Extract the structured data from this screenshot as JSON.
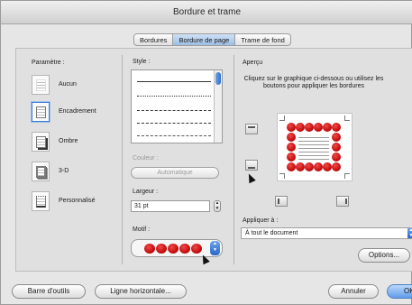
{
  "window": {
    "title": "Bordure et trame"
  },
  "tabs": [
    {
      "label": "Bordures"
    },
    {
      "label": "Bordure de page"
    },
    {
      "label": "Trame de fond"
    }
  ],
  "parametre": {
    "label": "Paramètre :",
    "items": [
      {
        "label": "Aucun",
        "icon": "border-none-icon"
      },
      {
        "label": "Encadrement",
        "icon": "border-box-icon",
        "selected": true
      },
      {
        "label": "Ombre",
        "icon": "border-shadow-icon"
      },
      {
        "label": "3-D",
        "icon": "border-3d-icon"
      },
      {
        "label": "Personnalisé",
        "icon": "border-custom-icon"
      }
    ]
  },
  "style": {
    "label": "Style :"
  },
  "couleur": {
    "label": "Couleur :",
    "value": "Automatique"
  },
  "largeur": {
    "label": "Largeur :",
    "value": "31 pt"
  },
  "motif": {
    "label": "Motif :"
  },
  "apercu": {
    "label": "Aperçu",
    "instructions": "Cliquez sur le graphique ci-dessous ou utilisez les boutons pour appliquer les bordures"
  },
  "appliquer": {
    "label": "Appliquer à :",
    "value": "À tout le document"
  },
  "buttons": {
    "options": "Options...",
    "toolbar": "Barre d'outils",
    "horizontal_line": "Ligne horizontale...",
    "cancel": "Annuler",
    "ok": "OK"
  },
  "colors": {
    "accent": "#3f7bd1",
    "motif_red": "#d11414"
  }
}
